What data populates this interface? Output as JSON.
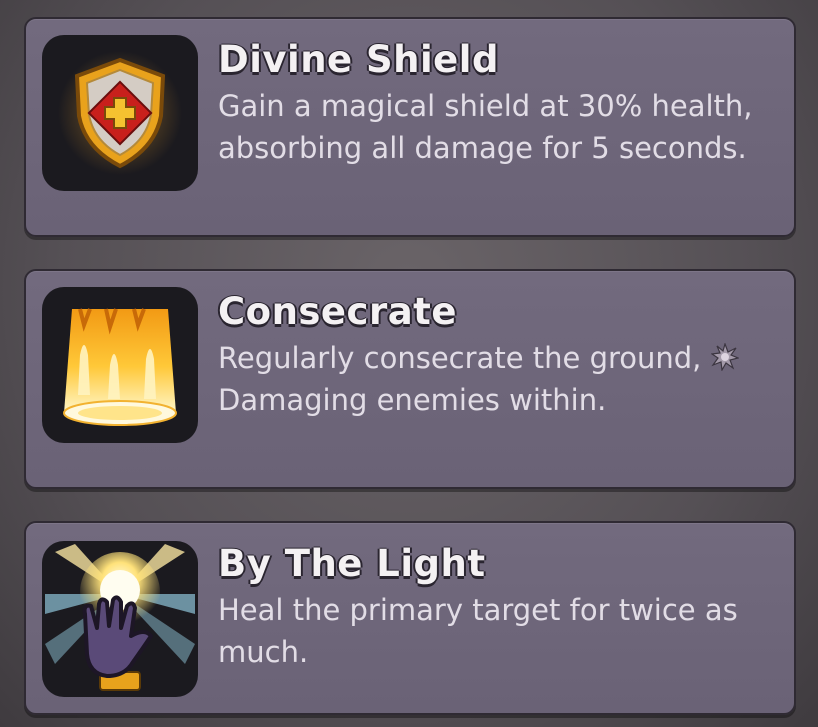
{
  "abilities": [
    {
      "title": "Divine Shield",
      "description": "Gain a magical shield at 30% health, absorbing all damage for 5 seconds.",
      "icon": "shield-cross-icon"
    },
    {
      "title": "Consecrate",
      "description_before": "Regularly consecrate the ground,",
      "description_keyword": "Damaging enemies",
      "description_after": "within.",
      "icon": "holy-light-beam-icon",
      "keyword_icon": "damage-burst-icon"
    },
    {
      "title": "By The Light",
      "description": "Heal the primary target for twice as much.",
      "icon": "hand-of-light-icon"
    }
  ],
  "colors": {
    "card": "#6e6679",
    "title": "#f4f1f3",
    "text": "#e2dde6",
    "icon_frame": "#1b1a1f"
  }
}
